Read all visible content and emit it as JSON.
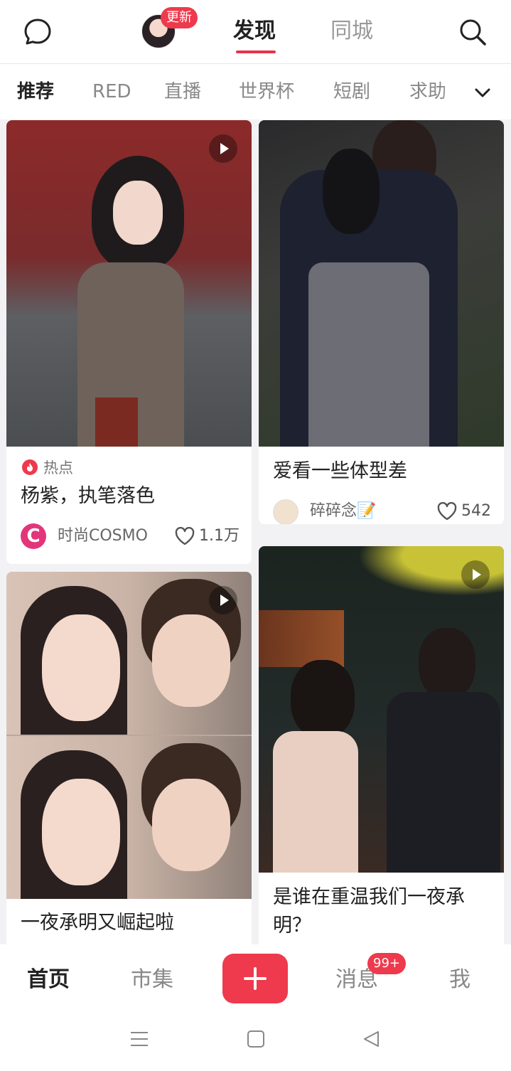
{
  "header": {
    "avatar_badge": "更新",
    "tabs": [
      {
        "label": "发现",
        "active": true
      },
      {
        "label": "同城",
        "active": false
      }
    ]
  },
  "categories": [
    {
      "label": "推荐",
      "active": true
    },
    {
      "label": "RED",
      "active": false
    },
    {
      "label": "直播",
      "active": false
    },
    {
      "label": "世界杯",
      "active": false
    },
    {
      "label": "短剧",
      "active": false
    },
    {
      "label": "求助",
      "active": false
    }
  ],
  "feed": [
    {
      "tag": "热点",
      "title": "杨紫，执笔落色",
      "author": "时尚COSMO",
      "likes": "1.1万",
      "video": true
    },
    {
      "title": "爱看一些体型差",
      "author": "碎碎念📝",
      "likes": "542",
      "video": false
    },
    {
      "title": "一夜承明又崛起啦",
      "video": true
    },
    {
      "title": "是谁在重温我们一夜承明？",
      "video": true
    }
  ],
  "bottom_nav": {
    "items": [
      "首页",
      "市集",
      "消息",
      "我"
    ],
    "messages_badge": "99+"
  },
  "colors": {
    "accent": "#ee3a4c"
  }
}
